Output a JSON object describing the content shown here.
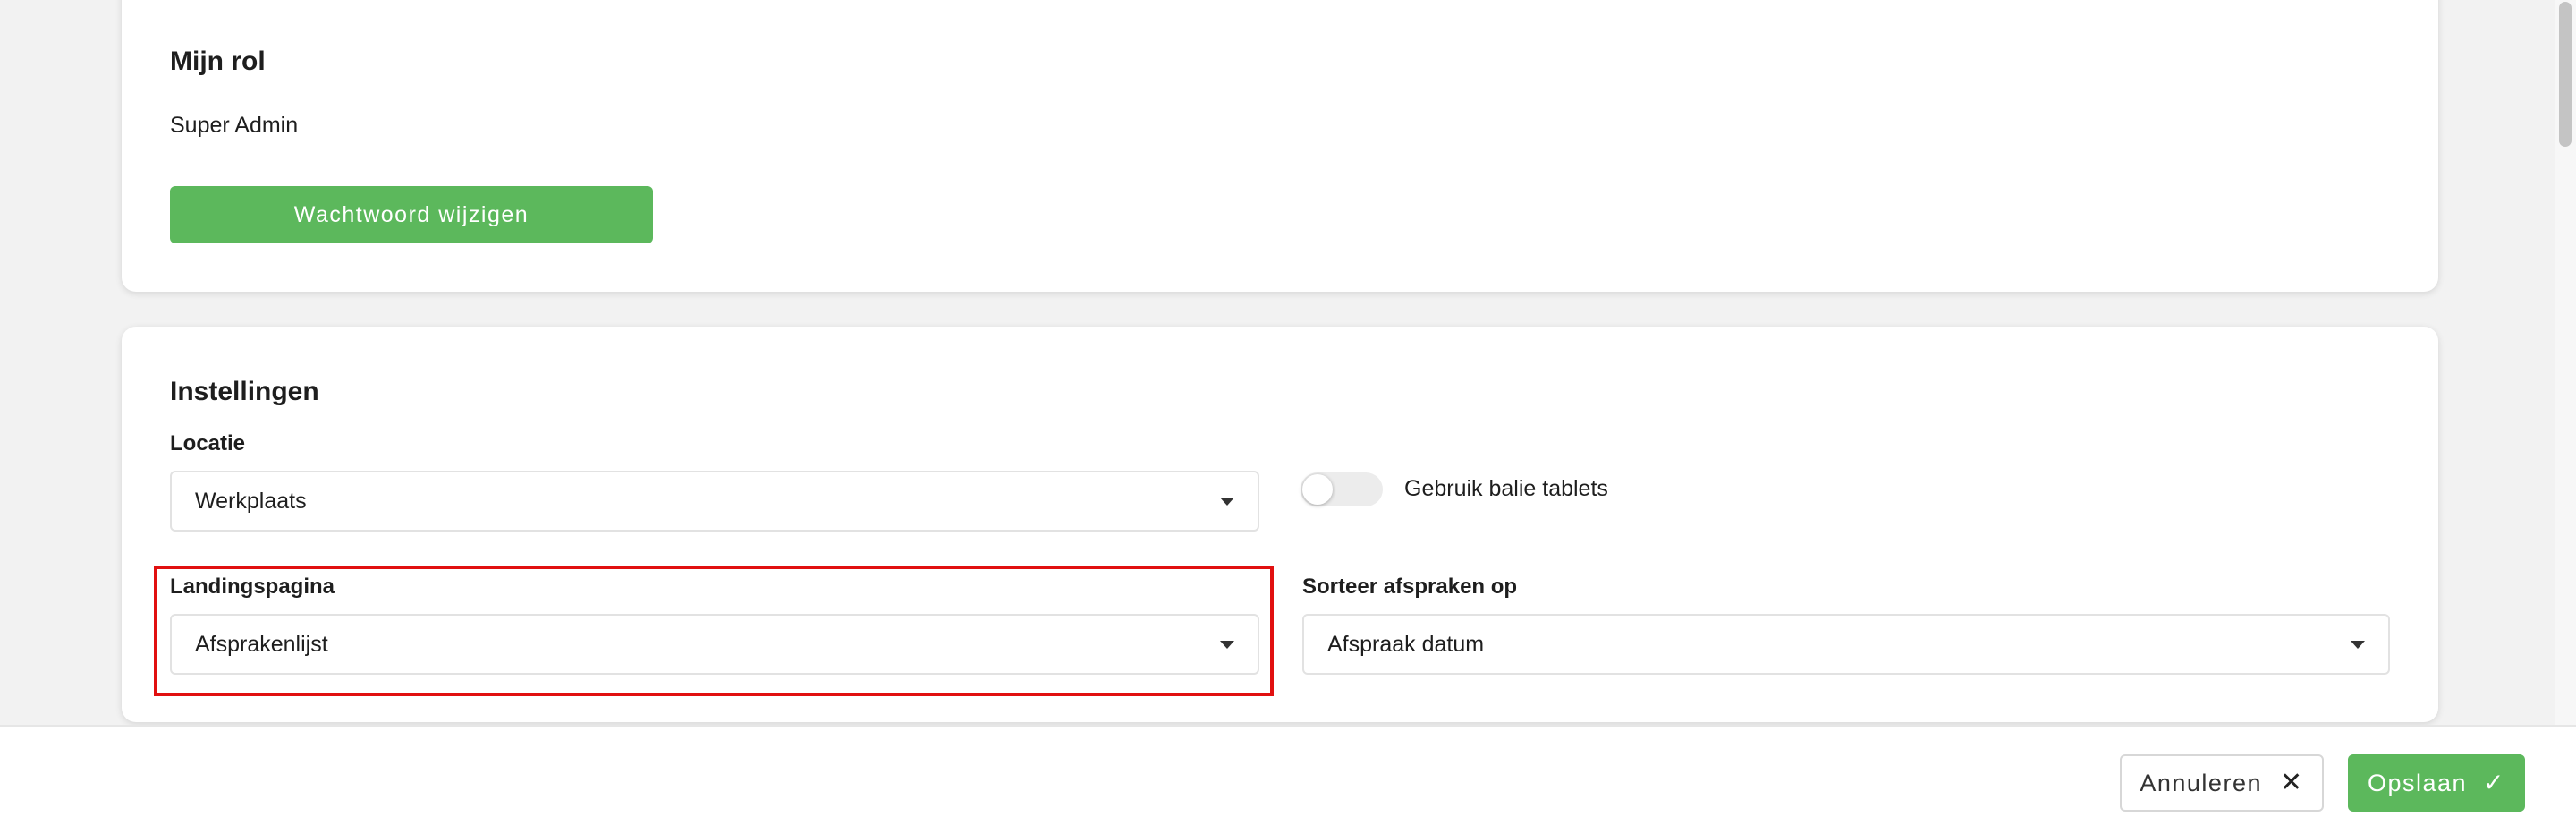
{
  "profile": {
    "role_heading": "Mijn rol",
    "role_value": "Super Admin",
    "change_password_label": "Wachtwoord wijzigen"
  },
  "settings": {
    "heading": "Instellingen",
    "location": {
      "label": "Locatie",
      "value": "Werkplaats"
    },
    "counter_tablets": {
      "label": "Gebruik balie tablets",
      "enabled": false
    },
    "landing_page": {
      "label": "Landingspagina",
      "value": "Afsprakenlijst"
    },
    "sort_appointments": {
      "label": "Sorteer afspraken op",
      "value": "Afspraak datum"
    }
  },
  "footer": {
    "cancel_label": "Annuleren",
    "save_label": "Opslaan"
  },
  "colors": {
    "primary_green": "#5cb85c",
    "highlight_red": "#e11010"
  },
  "icons": {
    "cancel": "close-icon",
    "save": "check-icon",
    "dropdown": "caret-down-icon"
  }
}
